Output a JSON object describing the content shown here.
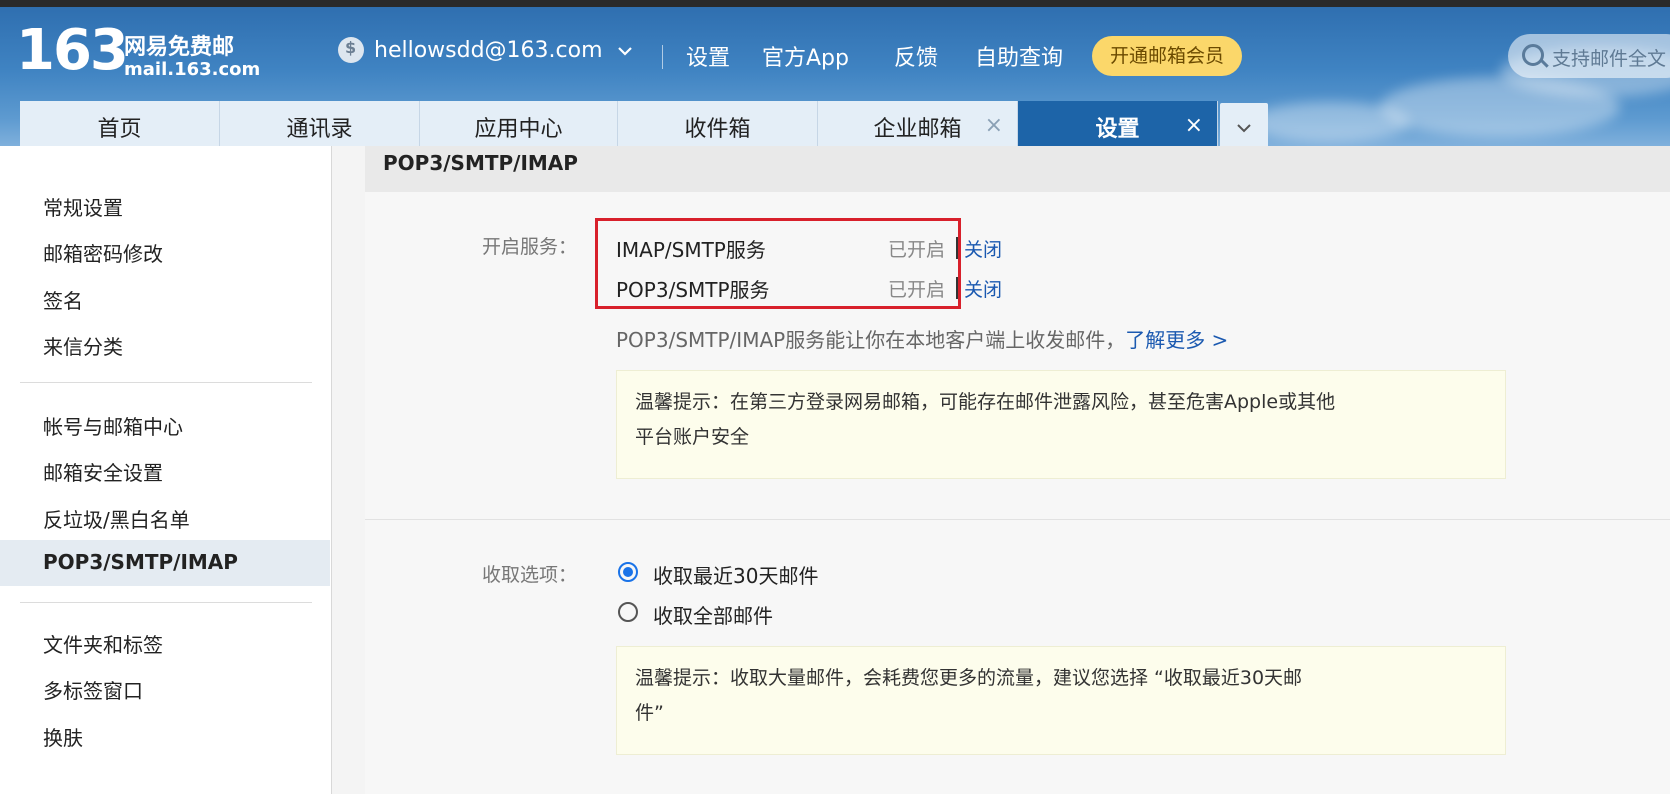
{
  "header": {
    "logo_number": "163",
    "logo_text": "网易免费邮",
    "logo_domain": "mail.163.com",
    "account": "hellowsdd@163.com",
    "links": [
      "设置",
      "官方App",
      "反馈",
      "自助查询"
    ],
    "vip_button": "开通邮箱会员",
    "search_placeholder": "支持邮件全文"
  },
  "tabs": [
    {
      "label": "首页"
    },
    {
      "label": "通讯录"
    },
    {
      "label": "应用中心"
    },
    {
      "label": "收件箱"
    },
    {
      "label": "企业邮箱",
      "close": "×"
    },
    {
      "label": "设置",
      "close": "×",
      "active": true
    }
  ],
  "sidebar": {
    "group1": [
      "常规设置",
      "邮箱密码修改",
      "签名",
      "来信分类"
    ],
    "group2": [
      "帐号与邮箱中心",
      "邮箱安全设置",
      "反垃圾/黑白名单",
      "POP3/SMTP/IMAP"
    ],
    "group3": [
      "文件夹和标签",
      "多标签窗口",
      "换肤"
    ],
    "active_item": "POP3/SMTP/IMAP"
  },
  "main": {
    "section_title": "POP3/SMTP/IMAP",
    "service_label": "开启服务：",
    "services": [
      {
        "name": "IMAP/SMTP服务",
        "status": "已开启",
        "action": "关闭"
      },
      {
        "name": "POP3/SMTP服务",
        "status": "已开启",
        "action": "关闭"
      }
    ],
    "info_text": "POP3/SMTP/IMAP服务能让你在本地客户端上收发邮件，",
    "learn_more": "了解更多 >",
    "tip1_line1": "温馨提示：在第三方登录网易邮箱，可能存在邮件泄露风险，甚至危害Apple或其他",
    "tip1_line2": "平台账户安全",
    "receive_label": "收取选项：",
    "receive_options": [
      {
        "label": "收取最近30天邮件",
        "selected": true
      },
      {
        "label": "收取全部邮件",
        "selected": false
      }
    ],
    "tip2_line1": "温馨提示：收取大量邮件，会耗费您更多的流量，建议您选择 “收取最近30天邮",
    "tip2_line2": "件”"
  },
  "colors": {
    "header_blue": "#3f83c2",
    "active_tab": "#1d64a8",
    "link_blue": "#1b59b0",
    "highlight_red": "#d8202b",
    "vip_yellow": "#fbd76a"
  }
}
